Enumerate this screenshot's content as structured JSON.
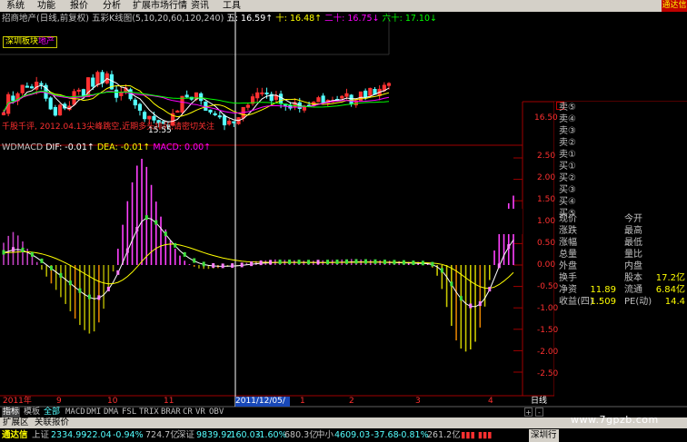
{
  "menu": {
    "items": [
      "系统",
      "功能",
      "报价",
      "分析",
      "扩展市场行情",
      "资讯",
      "工具"
    ],
    "corner_text": "通达信"
  },
  "price_header": {
    "title": "招商地产(日线,前复权)",
    "indicator": "五彩K线图(5,10,20,60,120,240)",
    "ma5_label": "五: 16.59↑",
    "ma10_label": "十: 16.48↑",
    "ma20_label": "二十: 16.75↓",
    "ma60_label": "六十: 17.10↓"
  },
  "sector_tag": {
    "prefix": "深圳板块",
    "suffix": "地产"
  },
  "note": "千股千评, 2012.04.13尖峰跳空,近期多头排列,请密切关注",
  "low_mark": "15.55",
  "price_axis_label": "16.50",
  "macd_header": {
    "name": "WDMACD",
    "dif": "DIF: -0.01↑",
    "dea": "DEA: -0.01↑",
    "macd": "MACD: 0.00↑"
  },
  "macd_axis": [
    "2.50",
    "2.00",
    "1.50",
    "1.00",
    "0.50",
    "0.00",
    "-0.50",
    "-1.00",
    "-1.50",
    "-2.00",
    "-2.50"
  ],
  "info_panel": {
    "orders": [
      "卖⑤",
      "卖④",
      "卖③",
      "卖②",
      "卖①",
      "买①",
      "买②",
      "买③",
      "买④",
      "买⑤"
    ],
    "left_labels": [
      "现价",
      "涨跌",
      "涨幅",
      "总量",
      "外盘",
      "换手",
      "净资",
      "收益(四)"
    ],
    "right_labels": [
      "今开",
      "最高",
      "最低",
      "量比",
      "内盘",
      "股本",
      "流通",
      "PE(动)"
    ],
    "values_left": [
      "",
      "",
      "",
      "",
      "",
      "",
      "11.89",
      "1.509"
    ],
    "values_right": [
      "",
      "",
      "",
      "",
      "",
      "17.2亿",
      "6.84亿",
      "14.4"
    ]
  },
  "x_axis": {
    "labels": [
      "2011年",
      "9",
      "10",
      "11",
      "2011/12/05/一",
      "1",
      "2",
      "3",
      "4"
    ],
    "period": "日线"
  },
  "tabs": {
    "items": [
      "指标",
      "模板",
      "全部",
      "MACD",
      "DMI",
      "DMA",
      "FSL",
      "TRIX",
      "BRAR",
      "CR",
      "VR",
      "OBV"
    ],
    "active": "指标",
    "scroll": [
      "+",
      "-"
    ]
  },
  "ext_bar": {
    "items": [
      "扩展区",
      "关联报价"
    ]
  },
  "status": {
    "logo": "通达信",
    "sh_name": "上证",
    "sh_value": "2334.99",
    "sh_change": "-22.04",
    "sh_pct": "-0.94%",
    "sh_amount": "724.7亿",
    "sz_name": "深证",
    "sz_value": "9839.92",
    "sz_change": "-160.03",
    "sz_pct": "-1.60%",
    "sz_amount": "680.3亿",
    "zxb_name": "中小",
    "zxb_value": "4609.03",
    "zxb_change": "-37.68",
    "zxb_pct": "-0.81%",
    "zxb_amount": "261.2亿",
    "server": "深圳行"
  },
  "watermark": "www.7gpzb.com",
  "colors": {
    "up": "#ff3232",
    "down": "#54ffff",
    "ma_green": "#00ff00",
    "ma_yellow": "#ffff00",
    "ma_magenta": "#ff00ff"
  },
  "chart_data": [
    {
      "type": "line",
      "ylabel": "",
      "y_ticks": [
        16.5
      ],
      "series": [
        {
          "values": [
            15.93,
            16.34,
            16.2,
            16.36,
            16.55,
            16.51,
            16.49,
            16.62,
            16.57,
            16.25,
            16.01,
            15.87,
            16.1,
            16.03,
            16.08,
            16.41,
            16.44,
            16.29,
            16.72,
            16.52,
            16.84,
            16.6,
            16.81,
            16.46,
            16.27,
            16.39,
            16.49,
            16.24,
            16.1,
            15.98,
            15.79,
            15.85,
            15.76,
            15.7,
            15.68,
            15.63,
            15.91,
            15.97,
            16.3,
            16.28,
            16.23,
            16.38,
            16.2,
            15.98,
            15.94,
            15.9,
            15.84,
            15.65,
            15.74,
            15.71,
            15.82,
            16.05,
            16.1,
            16.29,
            16.38,
            16.38,
            16.35,
            16.2,
            16.31,
            16.13,
            16.09,
            16.03,
            16.16,
            16.02,
            16.06,
            16.07,
            16.17,
            16.27,
            16.16,
            16.21,
            16.2,
            16.23,
            16.3,
            16.36,
            16.12,
            16.2,
            16.4,
            16.28,
            16.48,
            16.34,
            16.46,
            16.55,
            16.59
          ]
        }
      ]
    },
    {
      "type": "bar",
      "title": "WDMACD",
      "ylim": [
        -2.75,
        2.5
      ],
      "series": [
        {
          "name": "MACD",
          "values": [
            0.52,
            0.68,
            0.77,
            0.69,
            0.55,
            0.38,
            0.23,
            0.07,
            -0.11,
            -0.27,
            -0.43,
            -0.58,
            -0.75,
            -0.91,
            -1.08,
            -1.25,
            -1.4,
            -1.52,
            -1.6,
            -1.55,
            -1.34,
            -1.02,
            -0.61,
            -0.15,
            0.38,
            0.94,
            1.49,
            1.93,
            2.32,
            2.48,
            2.29,
            1.87,
            1.48,
            1.13,
            0.83,
            0.58,
            0.38,
            0.22,
            0.1,
            0.02,
            -0.04,
            -0.08,
            -0.09,
            -0.09,
            -0.08,
            -0.07,
            -0.06,
            -0.04,
            -0.03,
            -0.02,
            0.02,
            0.05,
            0.08,
            0.09,
            0.11,
            0.11,
            0.12,
            0.13,
            0.12,
            0.12,
            0.11,
            0.11,
            0.11,
            0.1,
            0.1,
            0.1,
            0.11,
            0.11,
            0.11,
            0.12,
            0.12,
            0.13,
            0.13,
            0.14,
            0.14,
            0.13,
            0.13,
            0.12,
            0.12,
            0.11,
            0.1,
            0.1,
            0.09,
            0.09,
            0.08,
            0.07,
            0.06,
            0.07,
            0.05,
            0.04,
            -0.06,
            -0.25,
            -0.56,
            -0.98,
            -1.42,
            -1.76,
            -1.95,
            -2.02,
            -1.97,
            -1.79,
            -1.46,
            -0.97,
            -0.35,
            0.34,
            0.89,
            1.25,
            1.44,
            1.62
          ]
        }
      ]
    }
  ]
}
